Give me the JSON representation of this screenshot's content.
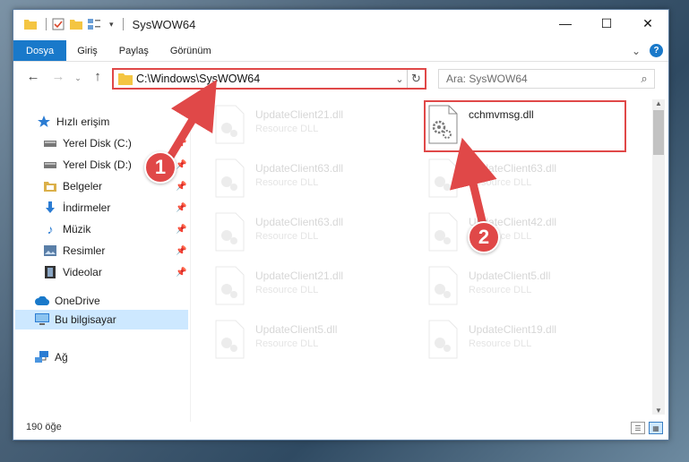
{
  "window": {
    "title": "SysWOW64",
    "controls": {
      "minimize": "—",
      "maximize": "☐",
      "close": "✕"
    }
  },
  "ribbon": {
    "tabs": [
      "Dosya",
      "Giriş",
      "Paylaş",
      "Görünüm"
    ],
    "expand": "⌄",
    "help": "?"
  },
  "address_bar": {
    "path": "C:\\Windows\\SysWOW64",
    "search_placeholder": "Ara: SysWOW64"
  },
  "nav_pane": {
    "items": [
      {
        "label": "Hızlı erişim",
        "icon": "star-icon",
        "pinned": false
      },
      {
        "label": "Yerel Disk (C:)",
        "icon": "drive-icon",
        "pinned": true
      },
      {
        "label": "Yerel Disk (D:)",
        "icon": "drive-icon",
        "pinned": true
      },
      {
        "label": "Belgeler",
        "icon": "documents-icon",
        "pinned": true
      },
      {
        "label": "İndirmeler",
        "icon": "download-icon",
        "pinned": true
      },
      {
        "label": "Müzik",
        "icon": "music-icon",
        "pinned": true
      },
      {
        "label": "Resimler",
        "icon": "pictures-icon",
        "pinned": true
      },
      {
        "label": "Videolar",
        "icon": "videos-icon",
        "pinned": true
      },
      {
        "label": "OneDrive",
        "icon": "cloud-icon",
        "pinned": false
      },
      {
        "label": "Bu bilgisayar",
        "icon": "computer-icon",
        "pinned": false,
        "selected": true
      },
      {
        "label": "Ağ",
        "icon": "network-icon",
        "pinned": false
      }
    ]
  },
  "files": {
    "left_column": [
      {
        "name": "UpdateClient21.dll",
        "type": "Resource DLL"
      },
      {
        "name": "UpdateClient63.dll",
        "type": "Resource DLL"
      },
      {
        "name": "UpdateClient63.dll",
        "type": "Resource DLL"
      },
      {
        "name": "UpdateClient21.dll",
        "type": "Resource DLL"
      },
      {
        "name": "UpdateClient5.dll",
        "type": "Resource DLL"
      }
    ],
    "right_column": [
      {
        "name": "cchmvmsg.dll",
        "type": "",
        "highlighted": true
      },
      {
        "name": "UpdateClient63.dll",
        "type": "Resource DLL"
      },
      {
        "name": "UpdateClient42.dll",
        "type": "Resource DLL"
      },
      {
        "name": "UpdateClient5.dll",
        "type": "Resource DLL"
      },
      {
        "name": "UpdateClient19.dll",
        "type": "Resource DLL"
      }
    ]
  },
  "status_bar": {
    "item_count": "190 öğe"
  },
  "annotations": {
    "step1": "1",
    "step2": "2",
    "color": "#e04848"
  }
}
